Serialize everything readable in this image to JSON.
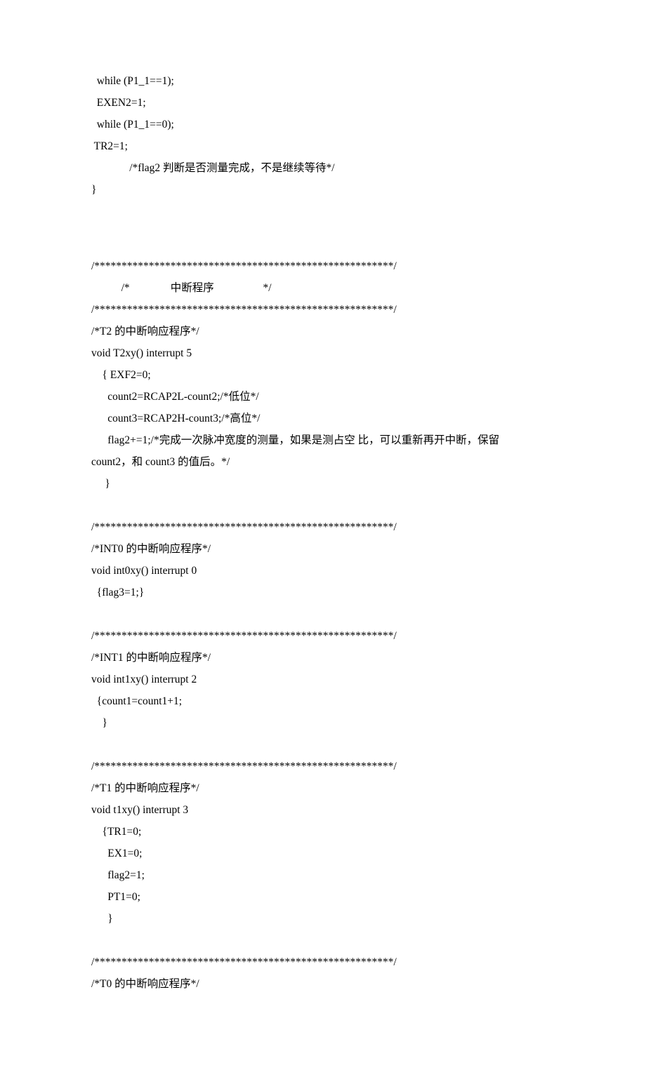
{
  "lines": {
    "l1": "  while (P1_1==1);",
    "l2": "  EXEN2=1;",
    "l3": "  while (P1_1==0);",
    "l4": " TR2=1;",
    "l5": "              /*flag2 判断是否测量完成，不是继续等待*/",
    "l6": "}",
    "sep1": "/*******************************************************/",
    "heading": "           /*               中断程序                  */",
    "sep2": "/*******************************************************/",
    "c1": "/*T2 的中断响应程序*/",
    "c2": "void T2xy() interrupt 5",
    "c3": "    { EXF2=0;",
    "c4": "      count2=RCAP2L-count2;/*低位*/",
    "c5": "      count3=RCAP2H-count3;/*高位*/",
    "c6a": "      flag2+=1;/*完成一次脉冲宽度的测量，如果是测占空 比，可以重新再开中断，保留",
    "c6b": "count2，和 count3 的值后。*/",
    "c7": "     }",
    "sep3": "/*******************************************************/",
    "d1": "/*INT0 的中断响应程序*/",
    "d2": "void int0xy() interrupt 0",
    "d3": "  {flag3=1;}",
    "sep4": "/*******************************************************/",
    "e1": "/*INT1 的中断响应程序*/",
    "e2": "void int1xy() interrupt 2",
    "e3": "  {count1=count1+1;",
    "e4": "    }",
    "sep5": "/*******************************************************/",
    "f1": "/*T1 的中断响应程序*/",
    "f2": "void t1xy() interrupt 3",
    "f3": "    {TR1=0;",
    "f4": "      EX1=0;",
    "f5": "      flag2=1;",
    "f6": "      PT1=0;",
    "f7": "      }",
    "sep6": "/*******************************************************/",
    "g1": "/*T0 的中断响应程序*/"
  }
}
